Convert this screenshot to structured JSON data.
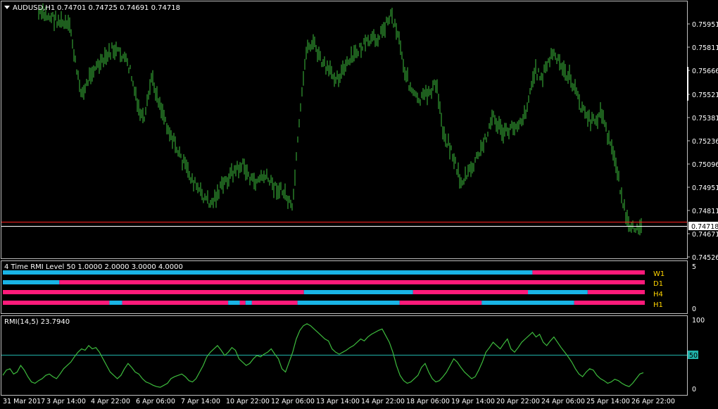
{
  "main_chart": {
    "header": {
      "symbol": "AUDUSD,H1",
      "ohlc": "0.74701 0.74725 0.74691 0.74718"
    },
    "y_ticks": [
      "0.75951",
      "0.75811",
      "0.75666",
      "0.75521",
      "0.75381",
      "0.75236",
      "0.75096",
      "0.74951",
      "0.74811",
      "0.74671",
      "0.74526"
    ],
    "current_price": "0.74718",
    "colors": {
      "candles": "#3dbb3d",
      "current_price_line": "#ff2020",
      "bid_line": "#ffffff",
      "tag_text": "#000000",
      "tag_bg": "#ffffff"
    }
  },
  "rmi_level_panel": {
    "title": "4 Time RMI Level 50 1.0000 2.0000 3.0000 4.0000",
    "y_ticks": [
      "5",
      "0"
    ],
    "rows": [
      {
        "label": "W1",
        "segments": [
          {
            "color": "blue",
            "from": 0.0,
            "to": 0.825
          },
          {
            "color": "pink",
            "from": 0.825,
            "to": 1.0
          }
        ]
      },
      {
        "label": "D1",
        "segments": [
          {
            "color": "blue",
            "from": 0.0,
            "to": 0.088
          },
          {
            "color": "pink",
            "from": 0.088,
            "to": 1.0
          }
        ]
      },
      {
        "label": "H4",
        "segments": [
          {
            "color": "pink",
            "from": 0.0,
            "to": 0.469
          },
          {
            "color": "blue",
            "from": 0.469,
            "to": 0.639
          },
          {
            "color": "pink",
            "from": 0.639,
            "to": 0.818
          },
          {
            "color": "blue",
            "from": 0.818,
            "to": 0.911
          },
          {
            "color": "pink",
            "from": 0.911,
            "to": 1.0
          }
        ]
      },
      {
        "label": "H1",
        "segments": [
          {
            "color": "pink",
            "from": 0.0,
            "to": 0.166
          },
          {
            "color": "blue",
            "from": 0.166,
            "to": 0.186
          },
          {
            "color": "pink",
            "from": 0.186,
            "to": 0.351
          },
          {
            "color": "blue",
            "from": 0.351,
            "to": 0.369
          },
          {
            "color": "pink",
            "from": 0.369,
            "to": 0.378
          },
          {
            "color": "blue",
            "from": 0.378,
            "to": 0.388
          },
          {
            "color": "pink",
            "from": 0.388,
            "to": 0.459
          },
          {
            "color": "blue",
            "from": 0.459,
            "to": 0.618
          },
          {
            "color": "pink",
            "from": 0.618,
            "to": 0.746
          },
          {
            "color": "blue",
            "from": 0.746,
            "to": 0.89
          },
          {
            "color": "pink",
            "from": 0.89,
            "to": 1.0
          }
        ]
      }
    ],
    "colors": {
      "blue": "#19b4e6",
      "pink": "#ff1a7a",
      "label": "#ffd400"
    }
  },
  "rmi_panel": {
    "title": "RMI(14,5) 23.7940",
    "y_ticks": [
      "100",
      "0"
    ],
    "level_tag": "50",
    "level": 50,
    "values": [
      20,
      28,
      30,
      22,
      25,
      35,
      28,
      18,
      10,
      8,
      12,
      15,
      20,
      22,
      18,
      15,
      22,
      30,
      35,
      40,
      48,
      55,
      60,
      58,
      65,
      60,
      62,
      55,
      45,
      35,
      25,
      20,
      15,
      20,
      30,
      38,
      32,
      25,
      22,
      15,
      10,
      8,
      5,
      3,
      2,
      5,
      8,
      15,
      18,
      20,
      22,
      18,
      12,
      10,
      15,
      25,
      35,
      48,
      55,
      60,
      65,
      58,
      50,
      55,
      62,
      58,
      45,
      40,
      35,
      38,
      45,
      50,
      48,
      52,
      55,
      60,
      52,
      45,
      30,
      25,
      40,
      55,
      75,
      88,
      95,
      98,
      95,
      90,
      85,
      80,
      75,
      72,
      60,
      55,
      52,
      55,
      58,
      62,
      65,
      70,
      75,
      72,
      78,
      82,
      85,
      88,
      90,
      80,
      70,
      55,
      35,
      20,
      12,
      8,
      10,
      15,
      20,
      32,
      38,
      25,
      15,
      10,
      12,
      18,
      25,
      35,
      45,
      40,
      32,
      25,
      20,
      15,
      18,
      28,
      40,
      55,
      62,
      70,
      65,
      60,
      68,
      75,
      60,
      55,
      62,
      70,
      75,
      80,
      85,
      78,
      82,
      70,
      65,
      72,
      78,
      70,
      62,
      55,
      48,
      40,
      30,
      22,
      18,
      25,
      30,
      28,
      20,
      15,
      12,
      8,
      10,
      14,
      12,
      8,
      5,
      3,
      8,
      15,
      22,
      24
    ]
  },
  "time_axis": [
    "31 Mar 2017",
    "3 Apr 14:00",
    "4 Apr 22:00",
    "6 Apr 06:00",
    "7 Apr 14:00",
    "10 Apr 22:00",
    "12 Apr 06:00",
    "13 Apr 14:00",
    "14 Apr 22:00",
    "18 Apr 06:00",
    "19 Apr 14:00",
    "20 Apr 22:00",
    "24 Apr 06:00",
    "25 Apr 14:00",
    "26 Apr 22:00"
  ]
}
